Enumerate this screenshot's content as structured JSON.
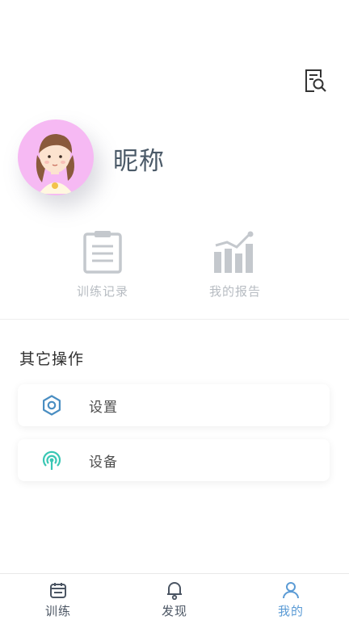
{
  "colors": {
    "accent": "#5b9bd5",
    "settings_icon": "#4a8ec2",
    "device_icon": "#39c7b4",
    "muted_text": "#b7bcc2",
    "nickname_text": "#4b5a68",
    "avatar_background": "#f6b9f3"
  },
  "header": {
    "report_search_icon": "report-search-icon"
  },
  "profile": {
    "avatar_icon": "girl-avatar",
    "nickname": "昵称"
  },
  "stats": [
    {
      "label": "训练记录",
      "icon": "clipboard-icon"
    },
    {
      "label": "我的报告",
      "icon": "bar-chart-trend-icon"
    }
  ],
  "other_operations": {
    "title": "其它操作",
    "items": [
      {
        "label": "设置",
        "icon": "gear-icon"
      },
      {
        "label": "设备",
        "icon": "device-signal-icon"
      }
    ]
  },
  "tabbar": {
    "tabs": [
      {
        "label": "训练",
        "icon": "calendar-icon",
        "active": false
      },
      {
        "label": "发现",
        "icon": "bell-icon",
        "active": false
      },
      {
        "label": "我的",
        "icon": "user-icon",
        "active": true
      }
    ]
  }
}
